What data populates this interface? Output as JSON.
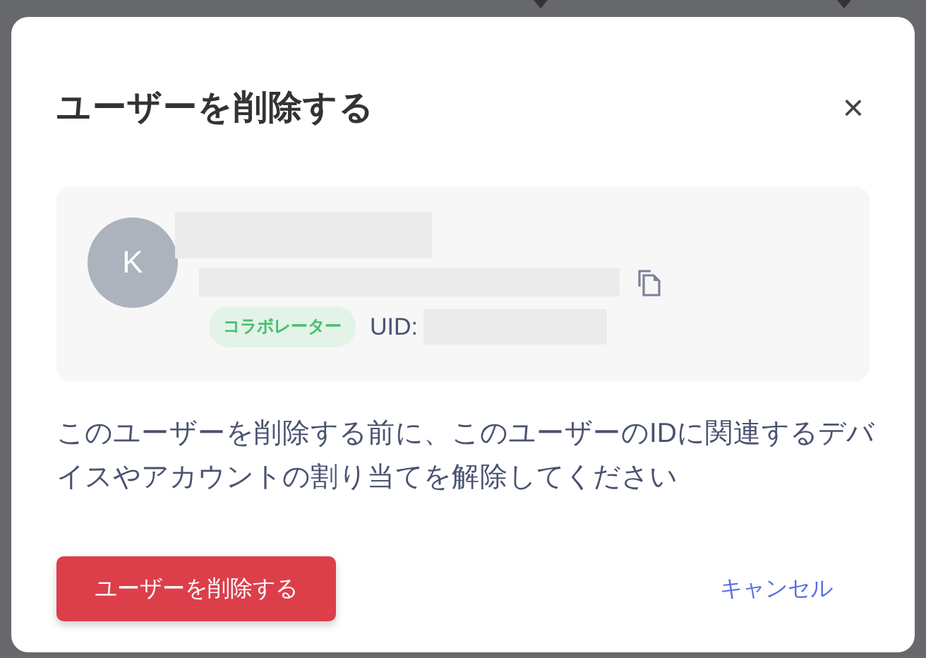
{
  "dialog": {
    "title": "ユーザーを削除する",
    "close": "×"
  },
  "user": {
    "avatar_initial": "K",
    "role_badge": "コラボレーター",
    "uid_label": "UID:"
  },
  "message": "このユーザーを削除する前に、このユーザーのIDに関連するデバイスやアカウントの割り当てを解除してください",
  "buttons": [
    {
      "kind": "danger",
      "label": "ユーザーを削除する"
    },
    {
      "kind": "link",
      "label": "キャンセル"
    }
  ]
}
